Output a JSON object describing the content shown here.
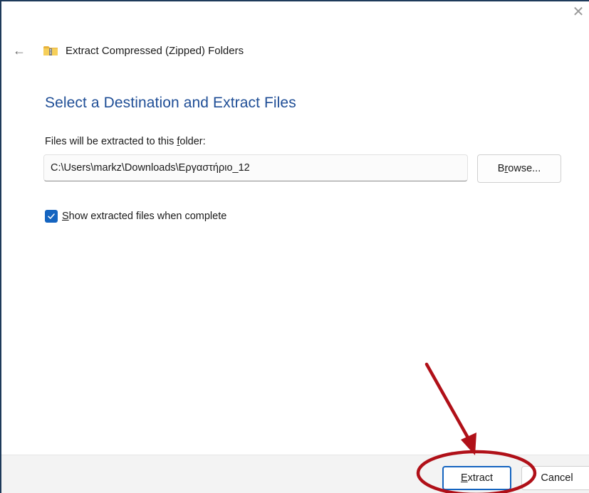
{
  "window": {
    "close_glyph": "✕",
    "back_glyph": "←",
    "title": "Extract Compressed (Zipped) Folders"
  },
  "main": {
    "heading": "Select a Destination and Extract Files",
    "folder_label_pre": "Files will be extracted to this ",
    "folder_label_accel": "f",
    "folder_label_post": "older:",
    "path_value": "C:\\Users\\markz\\Downloads\\Εργαστήριο_12",
    "browse_pre": "B",
    "browse_accel": "r",
    "browse_post": "owse...",
    "show_files_checked": true,
    "show_files_accel": "S",
    "show_files_post": "how extracted files when complete"
  },
  "footer": {
    "extract_accel": "E",
    "extract_post": "xtract",
    "cancel_label": "Cancel"
  },
  "icons": {
    "close": "close-icon",
    "back": "arrow-left-icon",
    "zip_folder": "zip-folder-icon",
    "checkmark": "checkmark-icon"
  },
  "colors": {
    "accent": "#1464c0",
    "heading": "#1f4e96",
    "annotation": "#b01018"
  }
}
